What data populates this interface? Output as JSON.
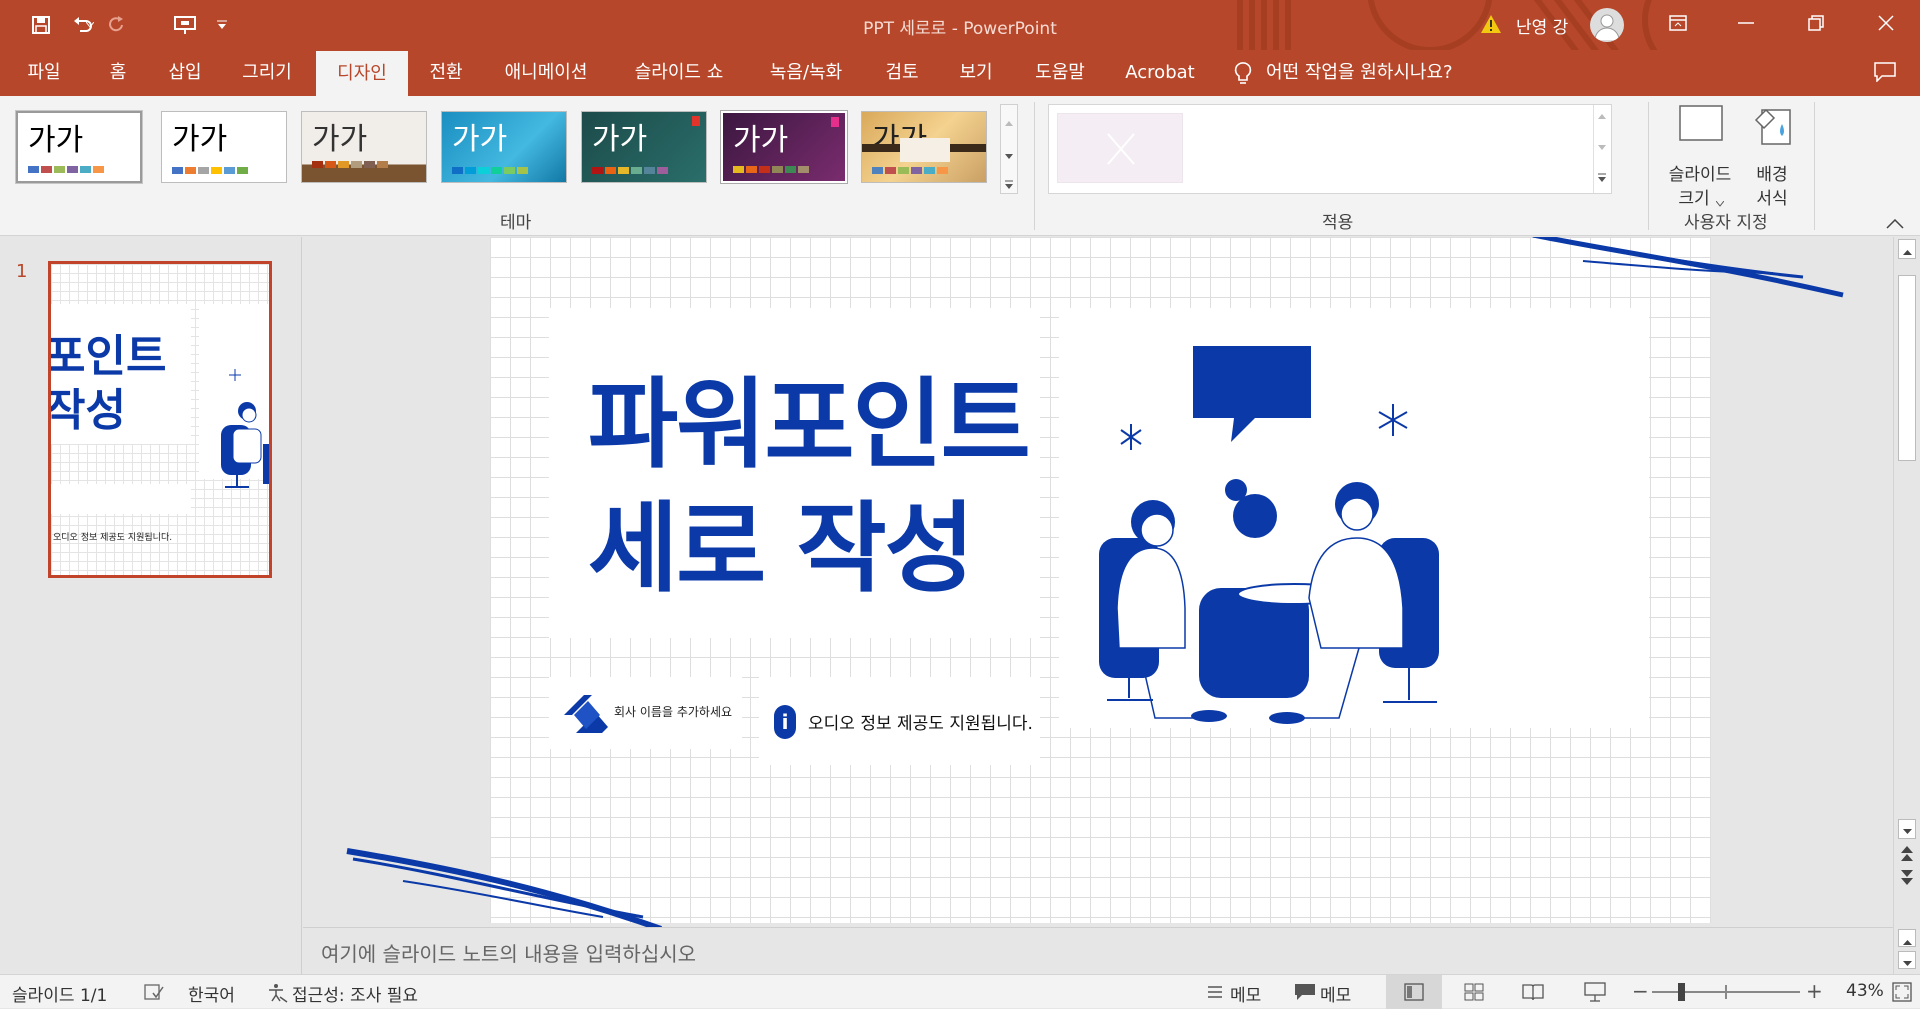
{
  "window": {
    "title": "PPT 세로로  -  PowerPoint",
    "user": "난영 강"
  },
  "tabs": [
    "파일",
    "홈",
    "삽입",
    "그리기",
    "디자인",
    "전환",
    "애니메이션",
    "슬라이드 쇼",
    "녹음/녹화",
    "검토",
    "보기",
    "도움말",
    "Acrobat"
  ],
  "active_tab": "디자인",
  "tell_me": "어떤 작업을 원하시나요?",
  "ribbon": {
    "themes_label": "테마",
    "theme_glyph": "가가",
    "apply_label": "적용",
    "customize_label": "사용자 지정",
    "slide_size": [
      "슬라이드",
      "크기"
    ],
    "background_format": [
      "배경",
      "서식"
    ]
  },
  "thumbnail": {
    "number": "1",
    "title_lines": [
      "포인트",
      "작성"
    ],
    "footer": "오디오 정보 제공도 지원됩니다."
  },
  "slide": {
    "title_lines": [
      "파워포인트",
      "세로 작성"
    ],
    "company": "회사 이름을 추가하세요",
    "info_mark": "i",
    "info": "오디오 정보 제공도 지원됩니다."
  },
  "notes_placeholder": "여기에 슬라이드 노트의 내용을 입력하십시오",
  "status": {
    "slide_counter": "슬라이드 1/1",
    "language": "한국어",
    "accessibility": "접근성: 조사 필요",
    "notes_btn": "메모",
    "comments_btn": "메모",
    "zoom": "43%"
  },
  "colors": {
    "accent": "#b7472a",
    "slide_blue": "#0b3aa8"
  }
}
